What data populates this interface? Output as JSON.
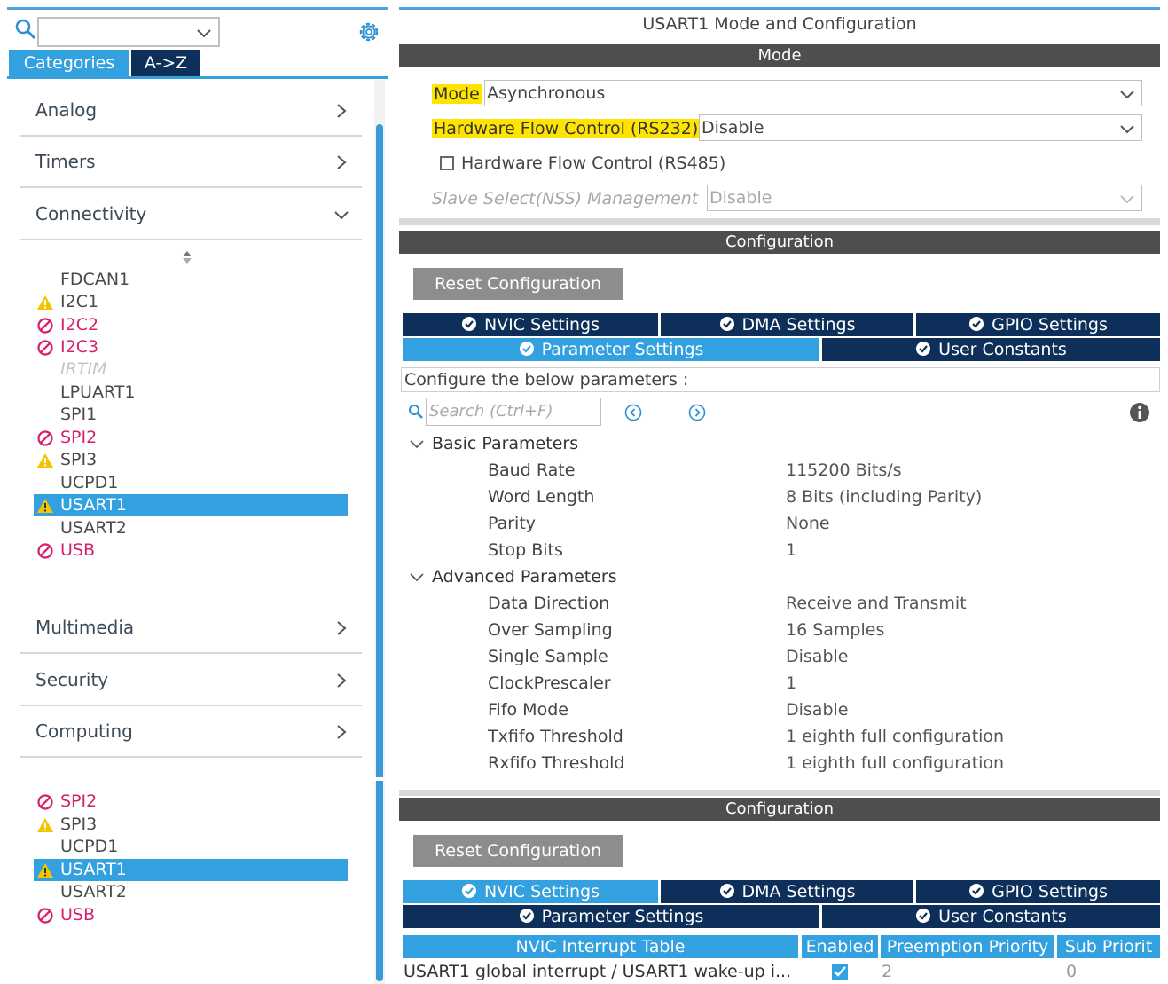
{
  "left_panel": {
    "search_combo_value": "",
    "tabs": {
      "categories": "Categories",
      "atoz": "A->Z"
    },
    "categories_top": [
      {
        "label": "Analog",
        "state": "collapsed"
      },
      {
        "label": "Timers",
        "state": "collapsed"
      },
      {
        "label": "Connectivity",
        "state": "expanded"
      }
    ],
    "connectivity_items": [
      {
        "label": "FDCAN1",
        "status": "ok"
      },
      {
        "label": "I2C1",
        "status": "warning"
      },
      {
        "label": "I2C2",
        "status": "error"
      },
      {
        "label": "I2C3",
        "status": "error"
      },
      {
        "label": "IRTIM",
        "status": "disabled"
      },
      {
        "label": "LPUART1",
        "status": "ok"
      },
      {
        "label": "SPI1",
        "status": "ok"
      },
      {
        "label": "SPI2",
        "status": "error"
      },
      {
        "label": "SPI3",
        "status": "warning"
      },
      {
        "label": "UCPD1",
        "status": "ok"
      },
      {
        "label": "USART1",
        "status": "warning",
        "selected": true
      },
      {
        "label": "USART2",
        "status": "ok"
      },
      {
        "label": "USB",
        "status": "error"
      }
    ],
    "categories_bottom": [
      {
        "label": "Multimedia",
        "state": "collapsed"
      },
      {
        "label": "Security",
        "state": "collapsed"
      },
      {
        "label": "Computing",
        "state": "collapsed"
      }
    ]
  },
  "left_panel_bottom": {
    "items": [
      {
        "label": "SPI2",
        "status": "error"
      },
      {
        "label": "SPI3",
        "status": "warning"
      },
      {
        "label": "UCPD1",
        "status": "ok"
      },
      {
        "label": "USART1",
        "status": "warning",
        "selected": true
      },
      {
        "label": "USART2",
        "status": "ok"
      },
      {
        "label": "USB",
        "status": "error"
      }
    ]
  },
  "right_panel": {
    "title": "USART1 Mode and Configuration",
    "mode_header": "Mode",
    "mode": {
      "mode_label": "Mode",
      "mode_value": "Asynchronous",
      "hw_flow_label": "Hardware Flow Control (RS232)",
      "hw_flow_value": "Disable",
      "rs485_label": "Hardware Flow Control (RS485)",
      "rs485_checked": false,
      "nss_label": "Slave Select(NSS) Management",
      "nss_value": "Disable"
    },
    "config_header": "Configuration",
    "reset_button": "Reset Configuration",
    "tabs": {
      "nvic": "NVIC Settings",
      "dma": "DMA Settings",
      "gpio": "GPIO Settings",
      "parameter": "Parameter Settings",
      "user_constants": "User Constants",
      "active": "parameter"
    },
    "configure_note": "Configure the below parameters :",
    "search_placeholder": "Search (Ctrl+F)",
    "groups": [
      {
        "name": "Basic Parameters",
        "params": [
          {
            "name": "Baud Rate",
            "value": "115200 Bits/s"
          },
          {
            "name": "Word Length",
            "value": "8 Bits (including Parity)"
          },
          {
            "name": "Parity",
            "value": "None"
          },
          {
            "name": "Stop Bits",
            "value": "1"
          }
        ]
      },
      {
        "name": "Advanced Parameters",
        "params": [
          {
            "name": "Data Direction",
            "value": "Receive and Transmit"
          },
          {
            "name": "Over Sampling",
            "value": "16 Samples"
          },
          {
            "name": "Single Sample",
            "value": "Disable"
          },
          {
            "name": "ClockPrescaler",
            "value": "1"
          },
          {
            "name": "Fifo Mode",
            "value": "Disable"
          },
          {
            "name": "Txfifo Threshold",
            "value": "1 eighth full configuration"
          },
          {
            "name": "Rxfifo Threshold",
            "value": "1 eighth full configuration"
          }
        ]
      }
    ]
  },
  "right_panel_bottom": {
    "config_header": "Configuration",
    "reset_button": "Reset Configuration",
    "tabs": {
      "nvic": "NVIC Settings",
      "dma": "DMA Settings",
      "gpio": "GPIO Settings",
      "parameter": "Parameter Settings",
      "user_constants": "User Constants",
      "active": "nvic"
    },
    "table": {
      "headers": [
        "NVIC Interrupt Table",
        "Enabled",
        "Preemption Priority",
        "Sub Priorit"
      ],
      "rows": [
        {
          "name": "USART1 global interrupt / USART1 wake-up i...",
          "enabled": true,
          "preemption": "2",
          "sub": "0"
        }
      ]
    }
  },
  "colors": {
    "accent_blue": "#33a1e0",
    "dark_navy": "#0d2f5a",
    "header_gray": "#4e4e4e",
    "highlight_yellow": "#ffe400",
    "error_magenta": "#d6206b",
    "warning_yellow": "#f5c400"
  }
}
